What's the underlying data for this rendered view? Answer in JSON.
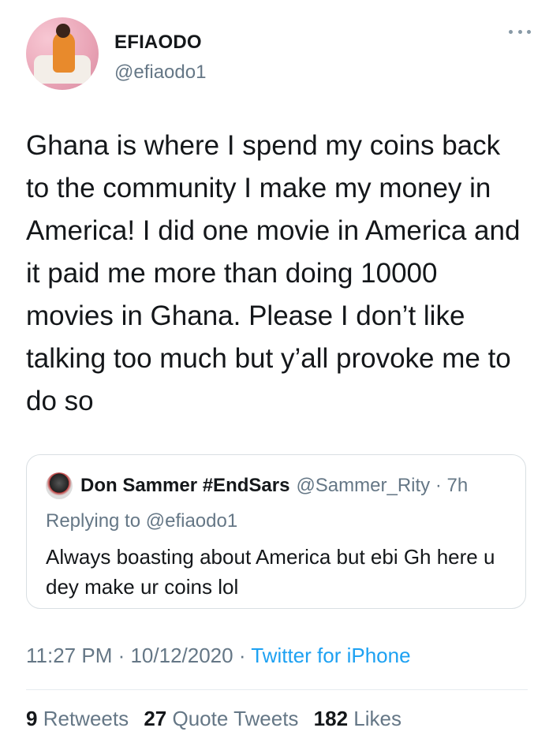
{
  "author": {
    "display_name": "EFIAODO",
    "handle": "@efiaodo1"
  },
  "tweet_text": "Ghana is where I spend my coins back to the community I make my money in America! I did one movie in America and it paid me more than doing 10000 movies in Ghana. Please I don’t like talking too much but y’all provoke me to do so",
  "quoted": {
    "display_name": "Don Sammer #EndSars",
    "handle_time": "@Sammer_Rity · 7h",
    "replying_prefix": "Replying to",
    "replying_to": "@efiaodo1",
    "text": "Always boasting about America but ebi Gh here u dey make ur coins lol"
  },
  "meta": {
    "time_date": "11:27 PM · 10/12/2020 · ",
    "source": "Twitter for iPhone"
  },
  "stats": {
    "retweets_count": "9",
    "retweets_label": "Retweets",
    "quotes_count": "27",
    "quotes_label": "Quote Tweets",
    "likes_count": "182",
    "likes_label": "Likes"
  },
  "colors": {
    "link": "#1da1f2",
    "muted": "#657786",
    "text": "#14171a"
  }
}
